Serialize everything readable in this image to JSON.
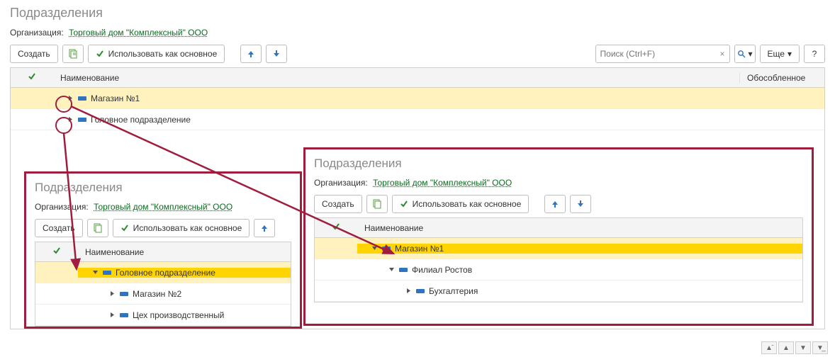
{
  "page_title": "Подразделения",
  "org_label": "Организация:",
  "org_value": "Торговый дом \"Комплексный\" ООО",
  "toolbar": {
    "create_label": "Создать",
    "use_as_main_label": "Использовать как основное",
    "more_label": "Еще",
    "search_placeholder": "Поиск (Ctrl+F)"
  },
  "grid_headers": {
    "name": "Наименование",
    "flag": "Обособленное"
  },
  "main_rows": [
    {
      "label": "Магазин №1",
      "expanded": false,
      "selected": "light",
      "indent": 0
    },
    {
      "label": "Головное подразделение",
      "expanded": false,
      "selected": "none",
      "indent": 0
    }
  ],
  "panel_a": {
    "title": "Подразделения",
    "rows": [
      {
        "label": "Головное подразделение",
        "expanded": true,
        "selected": "strong",
        "indent": 0
      },
      {
        "label": "Магазин №2",
        "expanded": false,
        "selected": "none",
        "indent": 1
      },
      {
        "label": "Цех производственный",
        "expanded": false,
        "selected": "none",
        "indent": 1
      }
    ]
  },
  "panel_b": {
    "title": "Подразделения",
    "rows": [
      {
        "label": "Магазин №1",
        "expanded": true,
        "selected": "strong",
        "indent": 0
      },
      {
        "label": "Филиал Ростов",
        "expanded": true,
        "selected": "none",
        "indent": 1
      },
      {
        "label": "Бухгалтерия",
        "expanded": false,
        "selected": "none",
        "indent": 2
      }
    ]
  }
}
